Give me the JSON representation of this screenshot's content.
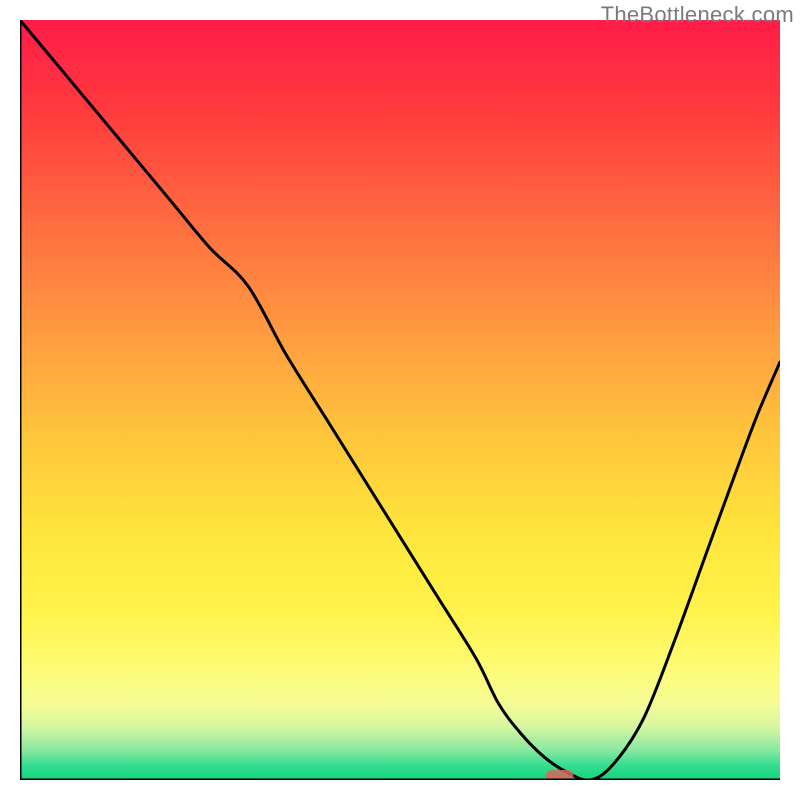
{
  "watermark": "TheBottleneck.com",
  "chart_data": {
    "type": "line",
    "title": "",
    "xlabel": "",
    "ylabel": "",
    "xlim": [
      0,
      100
    ],
    "ylim": [
      0,
      100
    ],
    "grid": false,
    "legend": false,
    "background": {
      "gradient_direction": "vertical",
      "stops": [
        {
          "pos": 0.0,
          "color": "#ff1c49"
        },
        {
          "pos": 0.12,
          "color": "#ff3a3d"
        },
        {
          "pos": 0.25,
          "color": "#ff6740"
        },
        {
          "pos": 0.4,
          "color": "#ff9740"
        },
        {
          "pos": 0.55,
          "color": "#ffc63c"
        },
        {
          "pos": 0.68,
          "color": "#ffe63c"
        },
        {
          "pos": 0.78,
          "color": "#fff34b"
        },
        {
          "pos": 0.85,
          "color": "#fdfb74"
        },
        {
          "pos": 0.9,
          "color": "#f6fc95"
        },
        {
          "pos": 0.93,
          "color": "#d6f6a0"
        },
        {
          "pos": 0.96,
          "color": "#8be9a0"
        },
        {
          "pos": 0.98,
          "color": "#36dd90"
        },
        {
          "pos": 1.0,
          "color": "#14d47e"
        }
      ]
    },
    "series": [
      {
        "name": "bottleneck-curve",
        "x": [
          0,
          5,
          10,
          15,
          20,
          25,
          30,
          35,
          40,
          45,
          50,
          55,
          60,
          63,
          66,
          69,
          72,
          75,
          78,
          82,
          86,
          90,
          94,
          97,
          100
        ],
        "y": [
          100,
          94,
          88,
          82,
          76,
          70,
          65,
          56,
          48,
          40,
          32,
          24,
          16,
          10,
          6,
          3,
          1,
          0,
          2,
          8,
          18,
          29,
          40,
          48,
          55
        ]
      }
    ],
    "annotations": [
      {
        "name": "optimal-marker",
        "x": 71,
        "y": 0,
        "shape": "rounded-rect",
        "color": "#d9655a"
      }
    ]
  }
}
